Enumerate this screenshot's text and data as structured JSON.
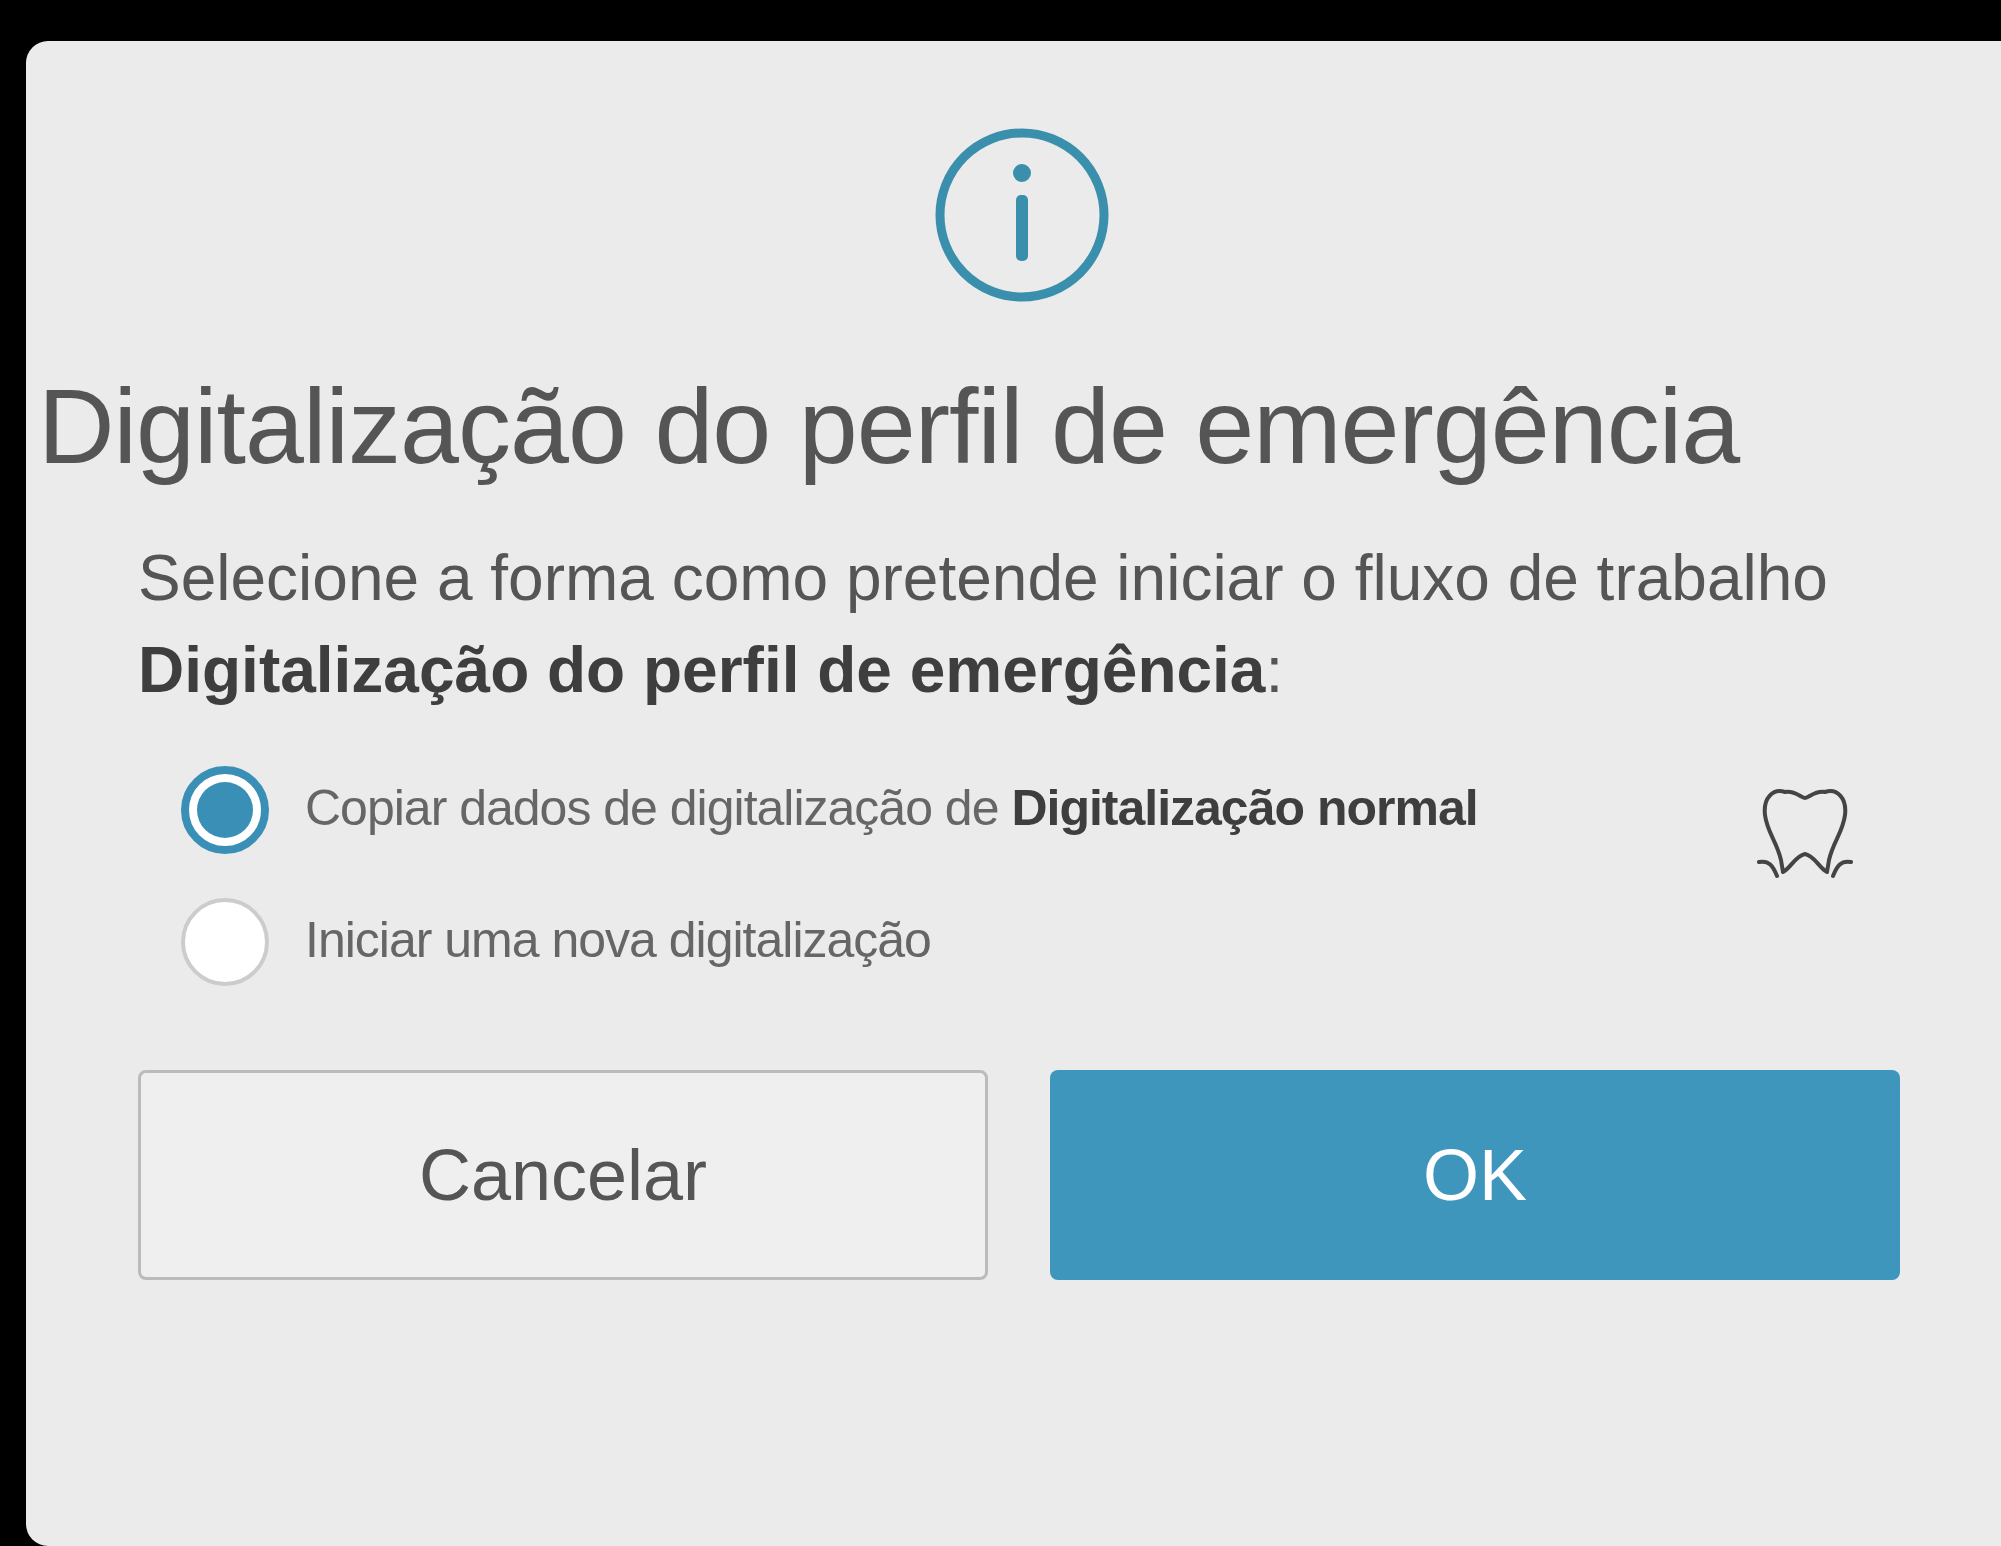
{
  "dialog": {
    "title": "Digitalização do perfil de emergência",
    "message": "Selecione a forma como pretende iniciar o fluxo de trabalho **Digitalização do perfil de emergência**:",
    "options": [
      {
        "label": "Copiar dados de digitalização de **Digitalização normal**",
        "selected": true
      },
      {
        "label": "Iniciar uma nova digitalização",
        "selected": false
      }
    ],
    "buttons": [
      {
        "label": "Cancelar",
        "kind": "secondary"
      },
      {
        "label": "OK",
        "kind": "primary"
      }
    ]
  }
}
